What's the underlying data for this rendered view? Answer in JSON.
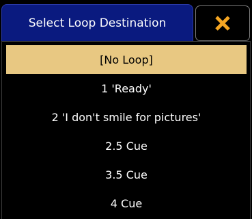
{
  "dialog": {
    "title": "Select Loop Destination"
  },
  "close_button": {
    "icon": "close-icon",
    "color": "#f5a623"
  },
  "colors": {
    "title_background": "#0a1a7f",
    "selected_background": "#e8c882",
    "background": "#000000"
  },
  "items": [
    {
      "label": "[No Loop]",
      "selected": true
    },
    {
      "label": "1 'Ready'",
      "selected": false
    },
    {
      "label": "2 'I don't smile for pictures'",
      "selected": false
    },
    {
      "label": "2.5 Cue",
      "selected": false
    },
    {
      "label": "3.5 Cue",
      "selected": false
    },
    {
      "label": "4 Cue",
      "selected": false
    }
  ]
}
